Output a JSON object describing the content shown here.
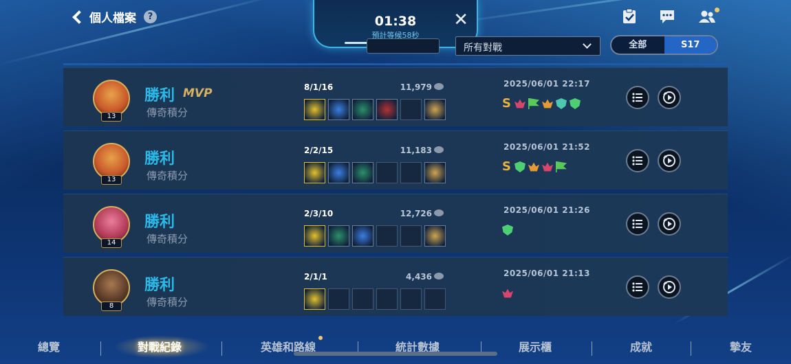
{
  "header": {
    "back_label": "個人檔案",
    "help_icon": "question-icon",
    "queue": {
      "time": "01:38",
      "estimate": "預計等候58秒",
      "close": "✕"
    },
    "hidden_button_label": "",
    "filter": {
      "selected": "所有對戰"
    },
    "season_toggle": [
      "全部",
      "S17"
    ],
    "season_selected": "S17",
    "icons": [
      "checklist-icon",
      "chat-icon",
      "friends-icon"
    ]
  },
  "matches": [
    {
      "result": "勝利",
      "mvp": "MVP",
      "mode": "傳奇積分",
      "level": "13",
      "kda": "8/1/16",
      "gold": "11,979",
      "date": "2025/06/01",
      "time": "22:17",
      "filled_items": 6,
      "badge_count": 6
    },
    {
      "result": "勝利",
      "mvp": "",
      "mode": "傳奇積分",
      "level": "13",
      "kda": "2/2/15",
      "gold": "11,183",
      "date": "2025/06/01",
      "time": "21:52",
      "filled_items": 4,
      "badge_count": 5
    },
    {
      "result": "勝利",
      "mvp": "",
      "mode": "傳奇積分",
      "level": "14",
      "kda": "2/3/10",
      "gold": "12,726",
      "date": "2025/06/01",
      "time": "21:26",
      "filled_items": 4,
      "badge_count": 1
    },
    {
      "result": "勝利",
      "mvp": "",
      "mode": "傳奇積分",
      "level": "8",
      "kda": "2/1/1",
      "gold": "4,436",
      "date": "2025/06/01",
      "time": "21:13",
      "filled_items": 1,
      "badge_count": 1
    }
  ],
  "bottom_nav": [
    "總覽",
    "對戰紀錄",
    "英雄和路線",
    "統計數據",
    "展示櫃",
    "成就",
    "摯友"
  ],
  "bottom_nav_active": "對戰紀錄",
  "colors": {
    "win": "#2bb9e8",
    "mvp": "#d7b160",
    "accent": "#2466c6",
    "queue_border": "#3db6e8"
  }
}
